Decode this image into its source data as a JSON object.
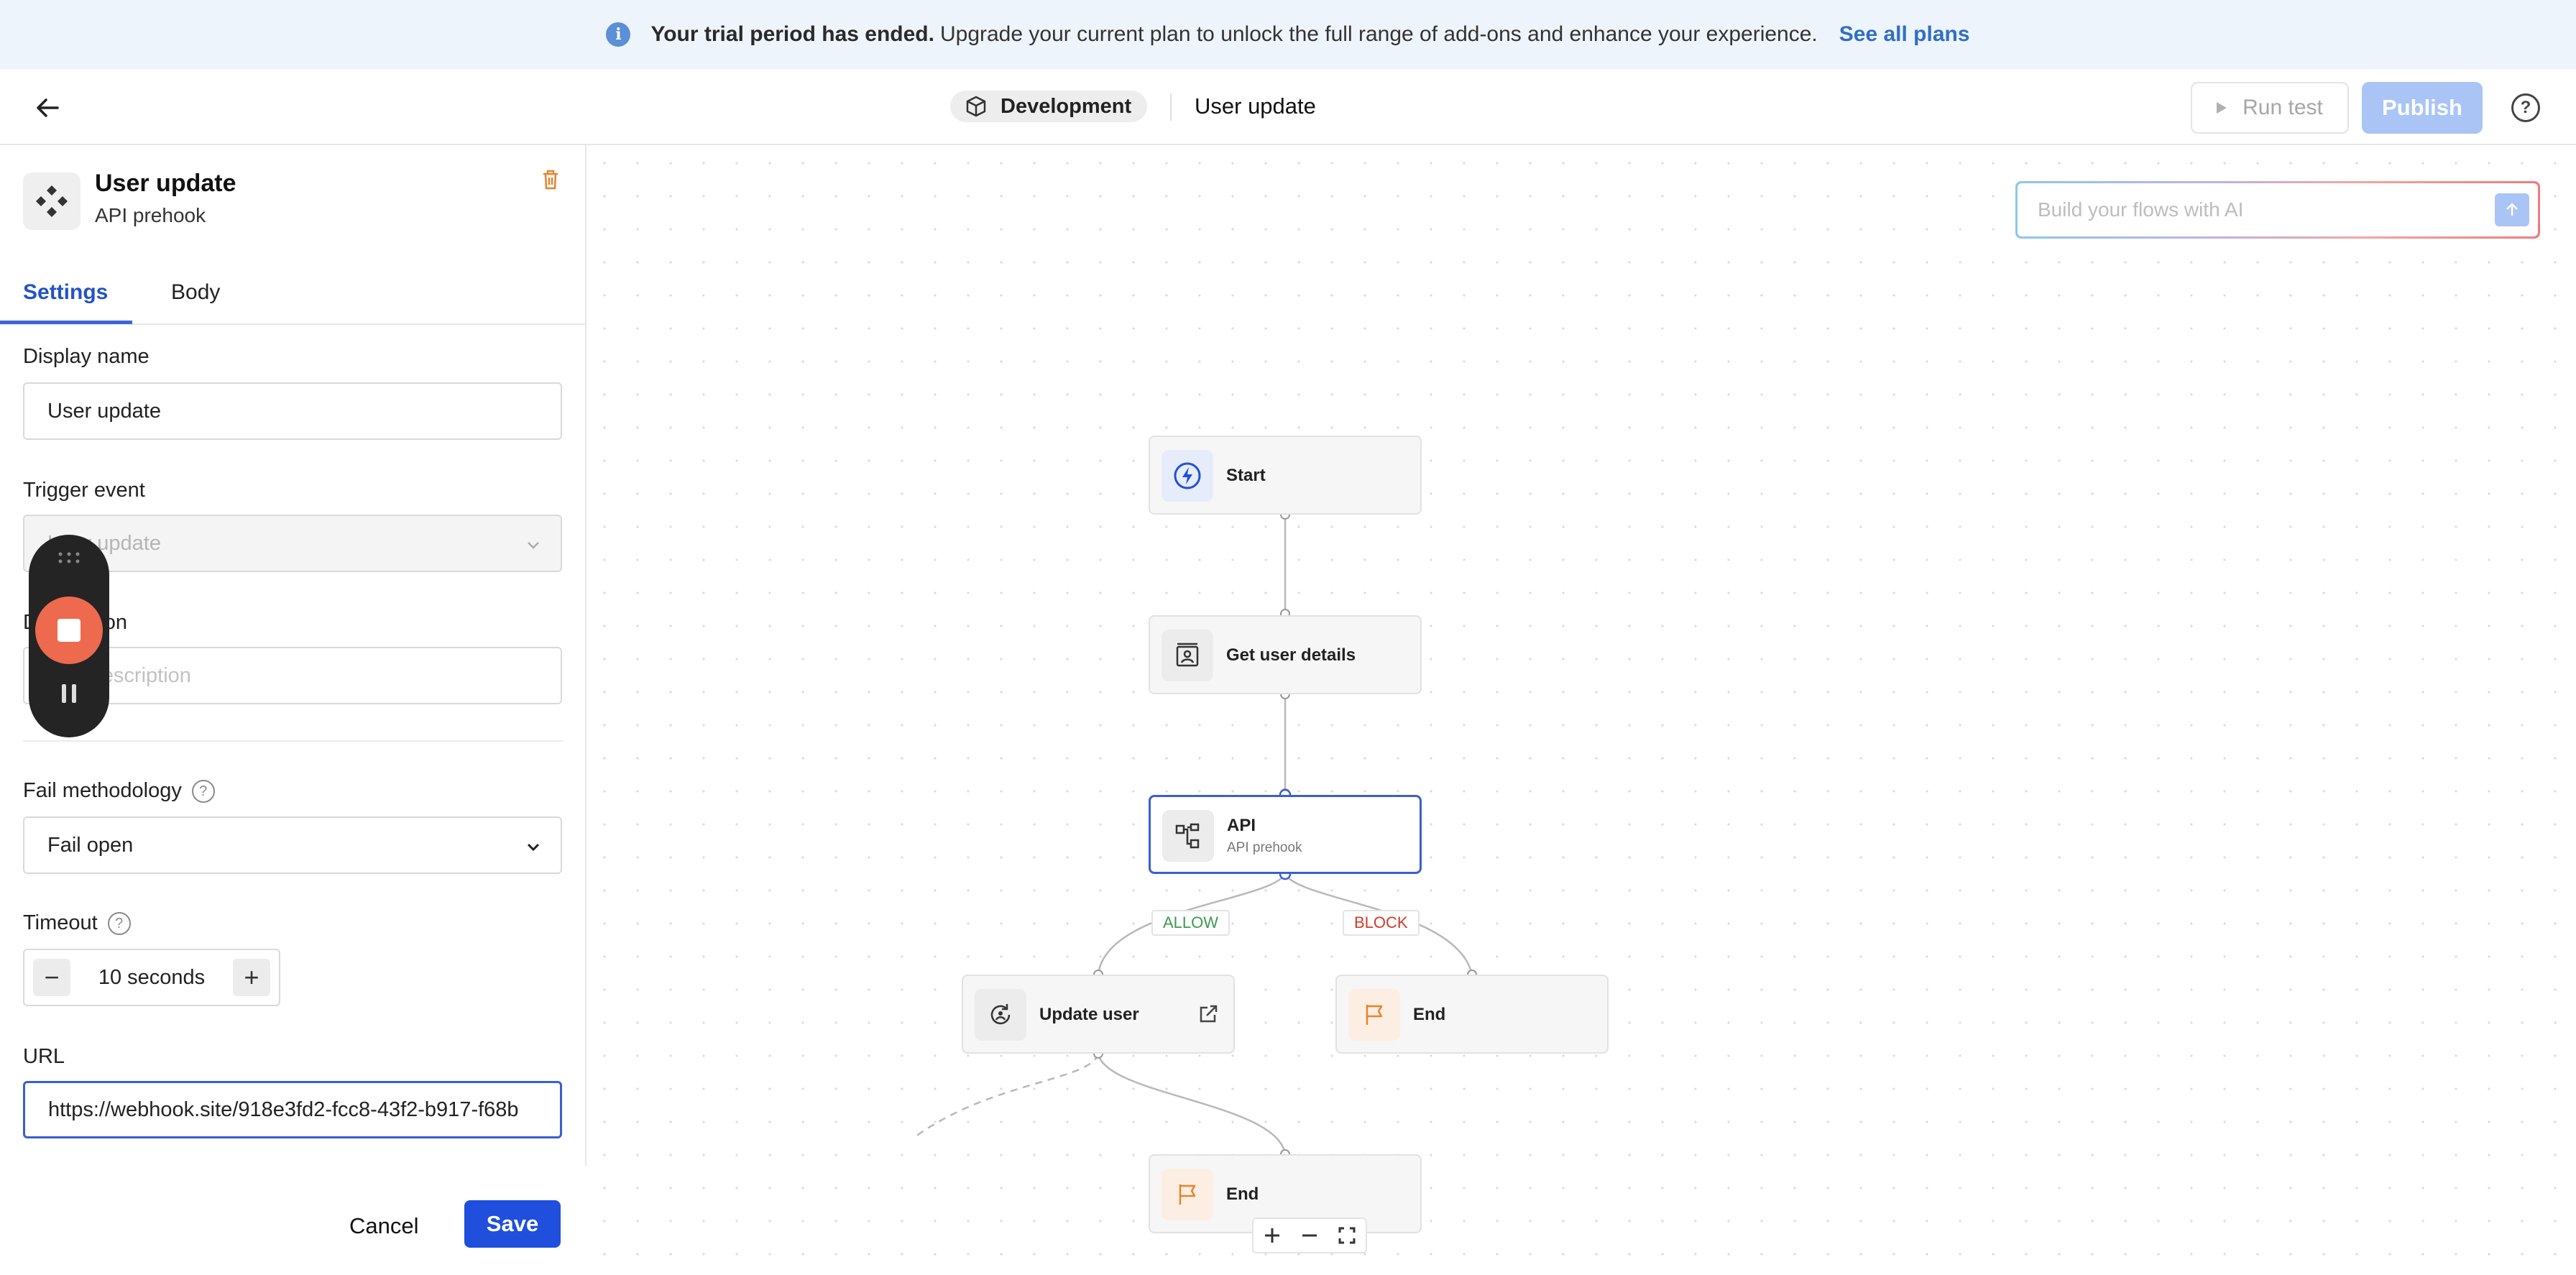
{
  "banner": {
    "bold": "Your trial period has ended.",
    "text": "Upgrade your current plan to unlock the full range of add-ons and enhance your experience.",
    "link": "See all plans"
  },
  "header": {
    "environment": "Development",
    "flow_title": "User update",
    "run_test": "Run test",
    "publish": "Publish"
  },
  "panel": {
    "title": "User update",
    "subtitle": "API prehook",
    "tabs": [
      "Settings",
      "Body"
    ],
    "display_name": {
      "label": "Display name",
      "value": "User update"
    },
    "trigger_event": {
      "label": "Trigger event",
      "value": "User update"
    },
    "description": {
      "label": "Description",
      "placeholder": "Add description"
    },
    "fail_methodology": {
      "label": "Fail methodology",
      "value": "Fail open"
    },
    "timeout": {
      "label": "Timeout",
      "value": "10 seconds"
    },
    "url": {
      "label": "URL",
      "value": "https://webhook.site/918e3fd2-fcc8-43f2-b917-f68b"
    },
    "cancel": "Cancel",
    "save": "Save"
  },
  "canvas": {
    "ai_placeholder": "Build your flows with AI",
    "nodes": {
      "start": "Start",
      "get_user": "Get user details",
      "api": "API",
      "api_sub": "API prehook",
      "update_user": "Update user",
      "end_right": "End",
      "end_bottom": "End"
    },
    "edge_labels": {
      "allow": "ALLOW",
      "block": "BLOCK"
    }
  },
  "colors": {
    "accent": "#2453c8",
    "save": "#1f4fdc",
    "publish_disabled": "#a9c4f5",
    "recorder_stop": "#ee6a4f"
  }
}
